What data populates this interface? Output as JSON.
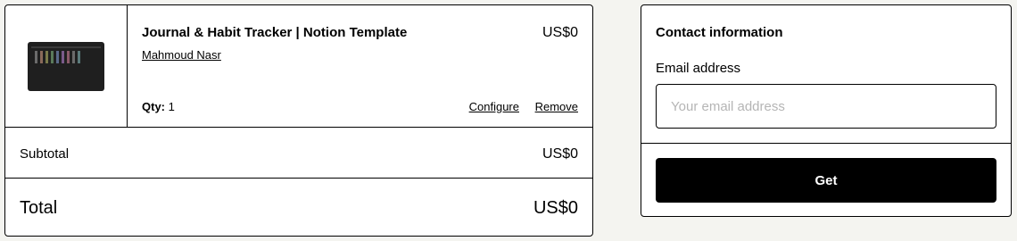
{
  "cart": {
    "item": {
      "title": "Journal & Habit Tracker | Notion Template",
      "price": "US$0",
      "seller": "Mahmoud Nasr",
      "qty_label": "Qty:",
      "qty_value": "1",
      "configure_label": "Configure",
      "remove_label": "Remove",
      "thumbnail_icon": "product-thumbnail"
    },
    "subtotal": {
      "label": "Subtotal",
      "value": "US$0"
    },
    "total": {
      "label": "Total",
      "value": "US$0"
    }
  },
  "contact": {
    "title": "Contact information",
    "email_label": "Email address",
    "email_placeholder": "Your email address",
    "email_value": "",
    "submit_label": "Get"
  },
  "colors": {
    "background": "#f4f4f0",
    "border": "#000000",
    "button_bg": "#000000",
    "button_text": "#ffffff",
    "placeholder": "#b5b5b5"
  }
}
